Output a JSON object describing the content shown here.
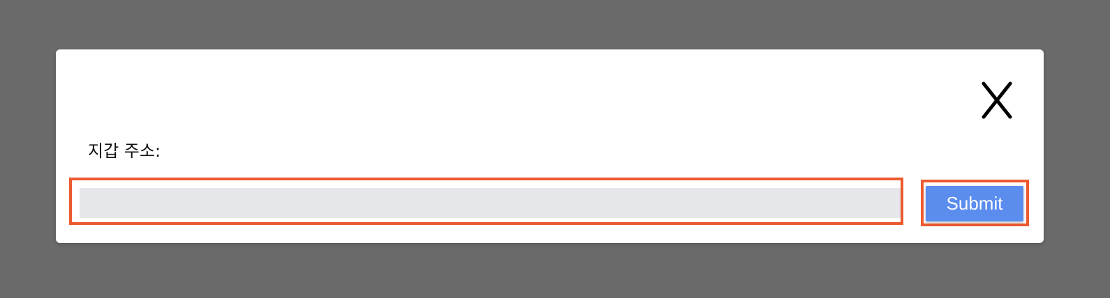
{
  "modal": {
    "label": "지갑 주소:",
    "input": {
      "value": "",
      "placeholder": ""
    },
    "submit_label": "Submit",
    "close_icon": "close-icon"
  },
  "colors": {
    "overlay": "#6a6a6a",
    "modal_bg": "#ffffff",
    "input_bg": "#e5e7eb",
    "button_bg": "#5b8def",
    "highlight": "#ec5a2f"
  }
}
